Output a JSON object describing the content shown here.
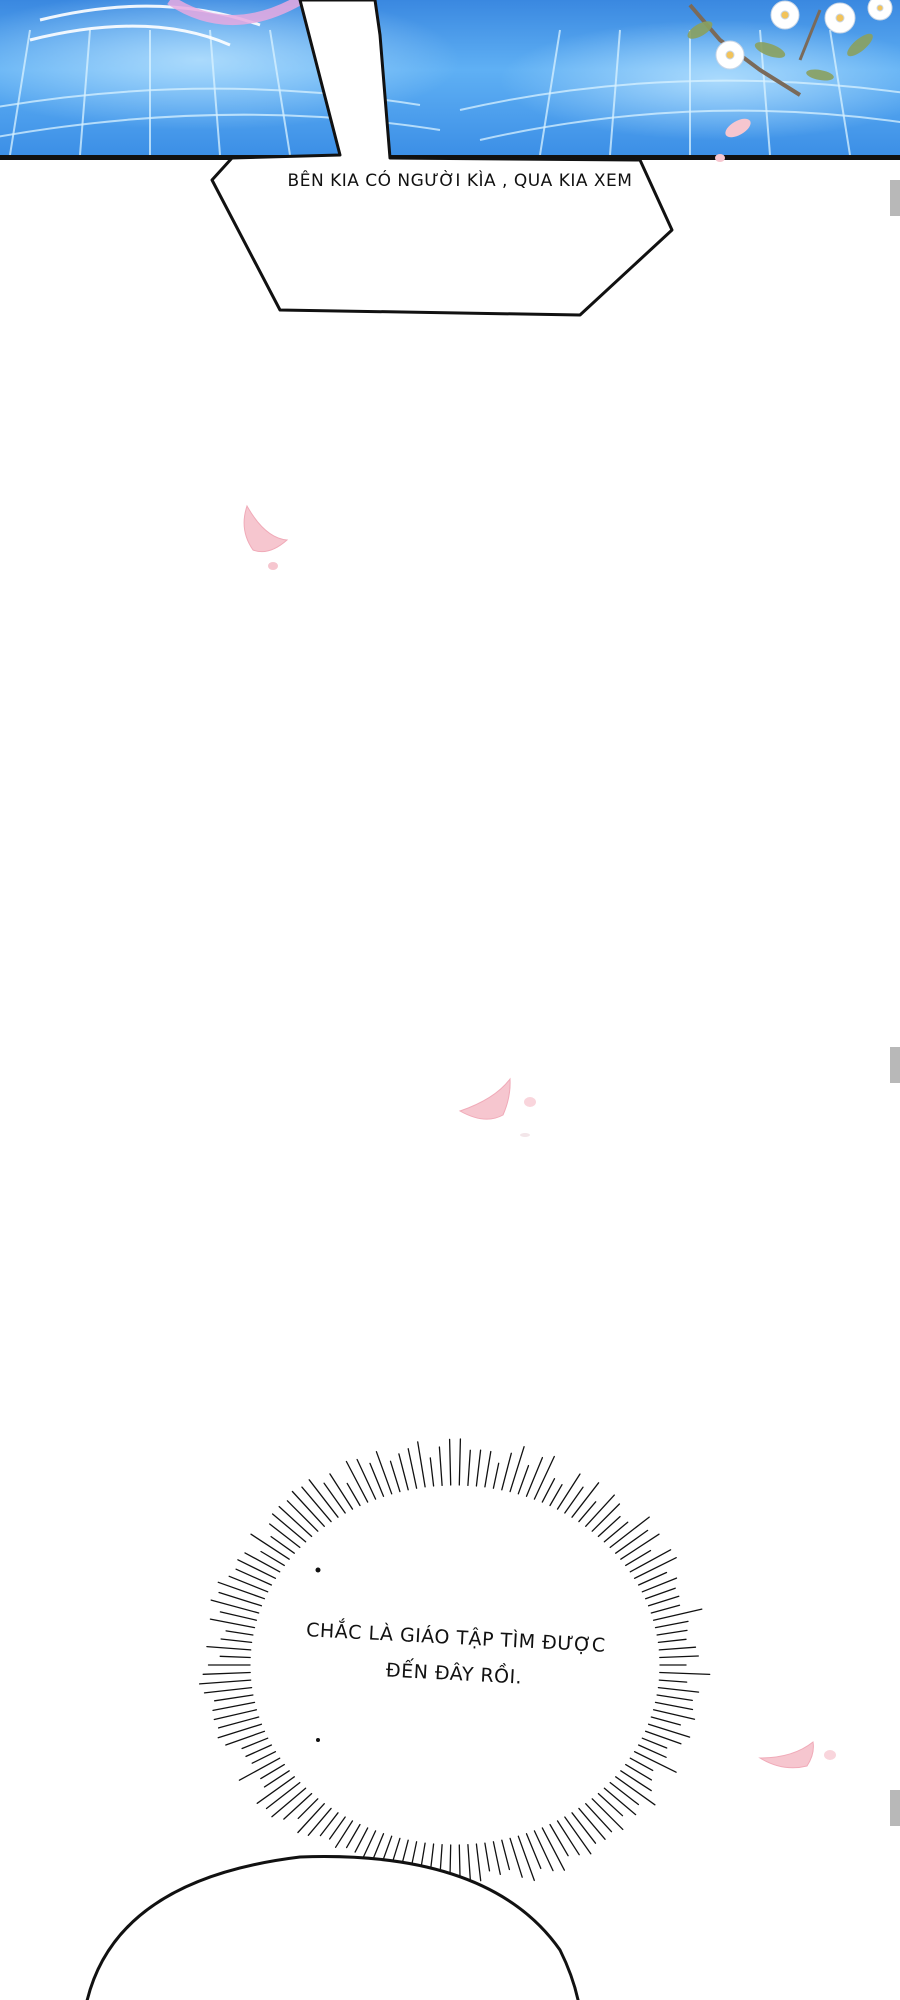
{
  "bubbles": {
    "first": "BÊN KIA CÓ NGƯỜI KÌA , QUA KIA XEM",
    "second": "CHẮC LÀ GIÁO TẬP TÌM ĐƯỢC ĐẾN ĐÂY RỒI."
  },
  "colors": {
    "sky": "#4a9de8",
    "petal": "#f6c6cf",
    "outline": "#111111"
  }
}
